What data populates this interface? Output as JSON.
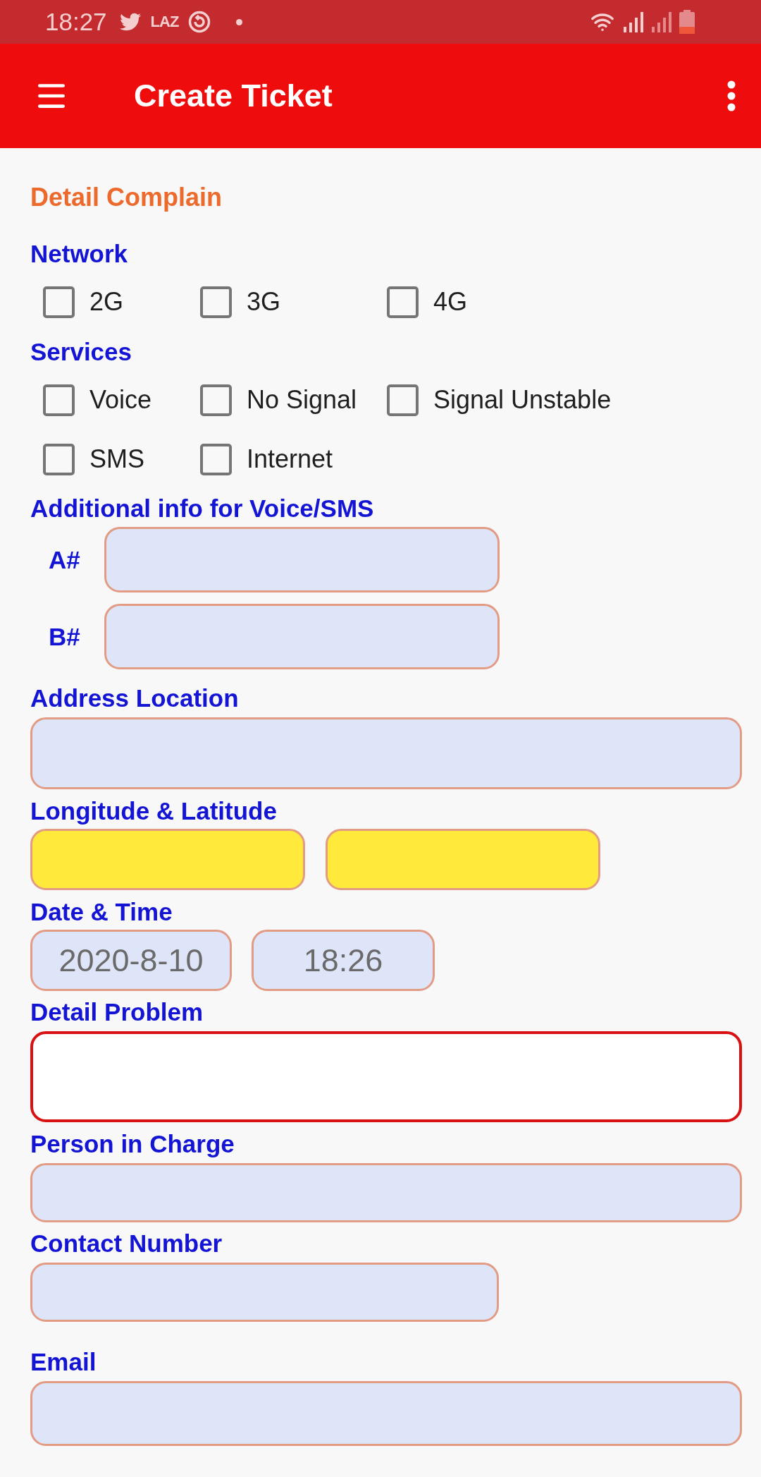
{
  "status_bar": {
    "time": "18:27",
    "notification_label": "LAZ"
  },
  "app_bar": {
    "title": "Create Ticket"
  },
  "form": {
    "section_title": "Detail Complain",
    "network": {
      "label": "Network",
      "options": [
        {
          "label": "2G",
          "checked": false
        },
        {
          "label": "3G",
          "checked": false
        },
        {
          "label": "4G",
          "checked": false
        }
      ]
    },
    "services": {
      "label": "Services",
      "options": [
        {
          "label": "Voice",
          "checked": false
        },
        {
          "label": "No Signal",
          "checked": false
        },
        {
          "label": "Signal Unstable",
          "checked": false
        },
        {
          "label": "SMS",
          "checked": false
        },
        {
          "label": "Internet",
          "checked": false
        }
      ]
    },
    "additional_info": {
      "label": "Additional info for Voice/SMS",
      "fields": [
        {
          "label": "A#"
        },
        {
          "label": "B#"
        }
      ]
    },
    "address_location": {
      "label": "Address Location"
    },
    "longitude_latitude": {
      "label": "Longitude & Latitude"
    },
    "date_time": {
      "label": "Date & Time",
      "date": "2020-8-10",
      "time": "18:26"
    },
    "detail_problem": {
      "label": "Detail Problem",
      "focused": true
    },
    "person_in_charge": {
      "label": "Person in Charge"
    },
    "contact_number": {
      "label": "Contact Number"
    },
    "email": {
      "label": "Email"
    }
  }
}
